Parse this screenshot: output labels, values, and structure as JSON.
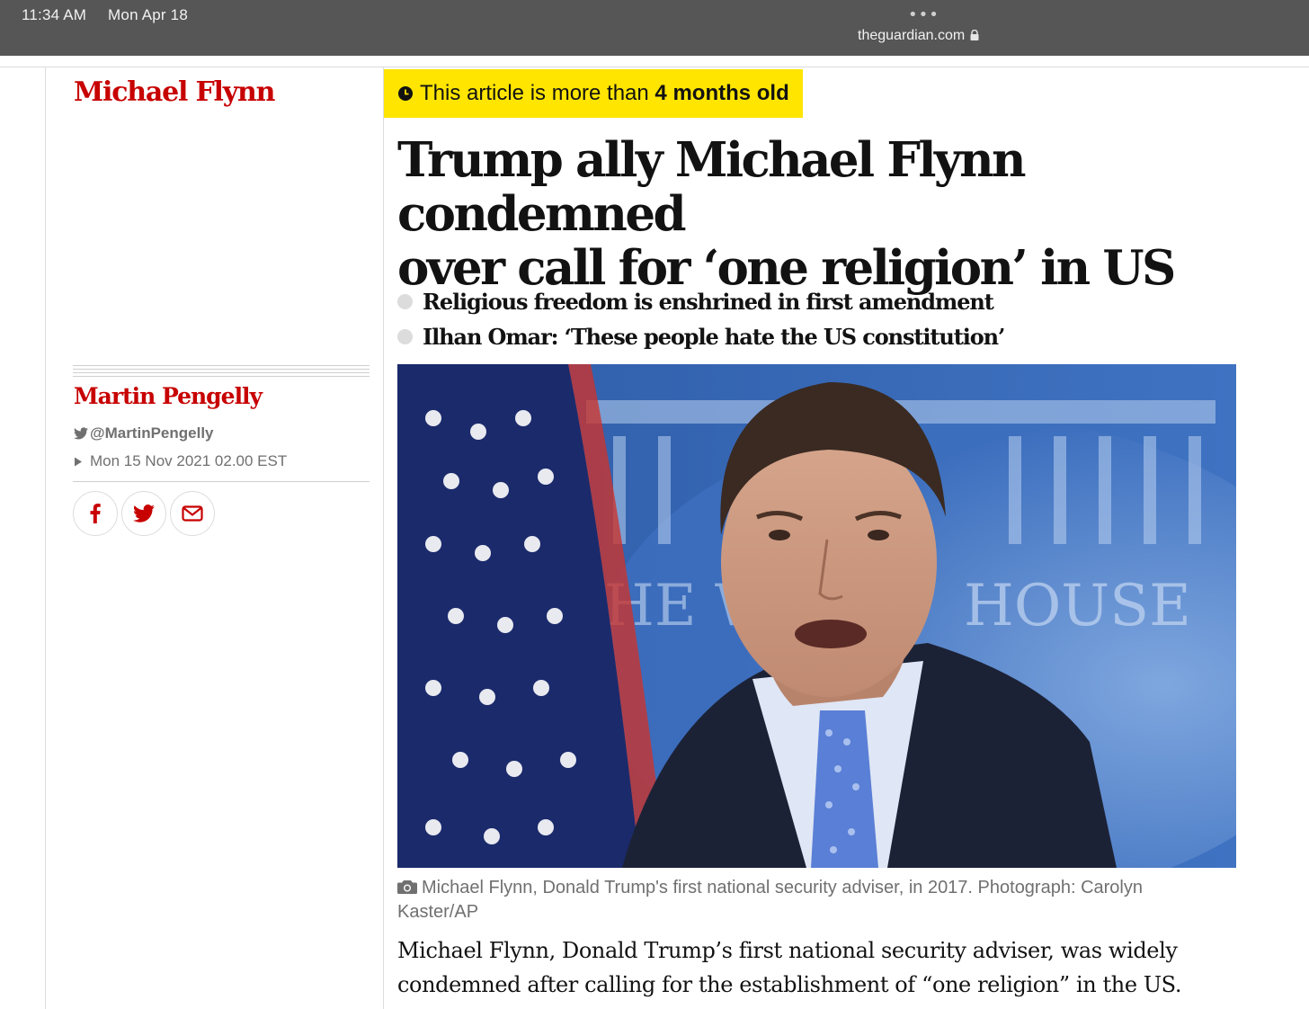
{
  "status_bar": {
    "time": "11:34 AM",
    "date": "Mon Apr 18",
    "dots": "•••",
    "url": "theguardian.com"
  },
  "article": {
    "section": "Michael Flynn",
    "age_warning": {
      "prefix": "This article is more than ",
      "age": "4 months old"
    },
    "headline_line1": "Trump ally Michael Flynn condemned",
    "headline_line2": "over call for ‘one religion’ in US",
    "standfirst": [
      "Religious freedom is enshrined in first amendment",
      "Ilhan Omar: ‘These people hate the US constitution’"
    ],
    "author": "Martin Pengelly",
    "twitter": "@MartinPengelly",
    "date": "Mon 15 Nov 2021 02.00 EST",
    "share": [
      "facebook",
      "twitter",
      "email"
    ],
    "hero_image_alt": "Michael Flynn speaking at the White House briefing room podium",
    "caption": "Michael Flynn, Donald Trump's first national security adviser, in 2017. Photograph: Carolyn Kaster/AP",
    "body_line1": "Michael Flynn, Donald Trump’s first national security adviser, was widely",
    "body_line2": "condemned after calling for the establishment of “one religion” in the US."
  },
  "colors": {
    "accent_red": "#c70000",
    "warning_yellow": "#ffe500",
    "muted_text": "#707070",
    "status_bar_bg": "#565656"
  }
}
